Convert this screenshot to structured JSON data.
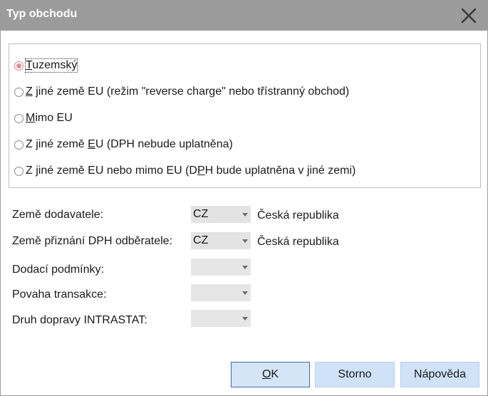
{
  "window": {
    "title": "Typ obchodu",
    "close_icon": "close-icon"
  },
  "trade_type": {
    "selected_index": 0,
    "options": [
      {
        "pre": "",
        "u": "T",
        "post": "uzemský"
      },
      {
        "pre": "",
        "u": "Z",
        "post": " jiné země EU (režim \"reverse charge\" nebo třístranný obchod)"
      },
      {
        "pre": "",
        "u": "M",
        "post": "imo EU"
      },
      {
        "pre": "Z jiné země ",
        "u": "E",
        "post": "U (DPH nebude uplatněna)"
      },
      {
        "pre": "Z jiné země EU nebo mimo EU (D",
        "u": "P",
        "post": "H bude uplatněna v jiné zemi)"
      }
    ]
  },
  "fields": {
    "supplier_country": {
      "label": "Země dodavatele:",
      "value": "CZ",
      "name": "Česká republika"
    },
    "vat_country": {
      "label": "Země přiznání DPH odběratele:",
      "value": "CZ",
      "name": "Česká republika"
    },
    "delivery_terms": {
      "label": "Dodací podmínky:",
      "value": ""
    },
    "transaction_nature": {
      "label": "Povaha transakce:",
      "value": ""
    },
    "transport_mode": {
      "label": "Druh dopravy INTRASTAT:",
      "value": ""
    }
  },
  "buttons": {
    "ok": {
      "u": "O",
      "post": "K"
    },
    "cancel": "Storno",
    "help": "Nápověda"
  },
  "colors": {
    "titlebar": "#9b9b9b",
    "button_bg": "#cfe2f7",
    "radio_selected": "#e08c9a"
  }
}
